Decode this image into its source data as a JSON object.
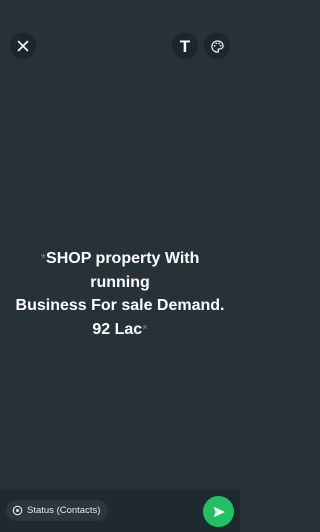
{
  "top_bar": {
    "close_icon": "close-icon",
    "text_tool_label": "T",
    "palette_icon": "palette-icon"
  },
  "status": {
    "line_1": "SHOP property With running",
    "line_2": "Business For sale Demand.",
    "line_3": "92 Lac"
  },
  "bottom_bar": {
    "audience_label": "Status (Contacts)",
    "send_icon": "send-icon"
  },
  "colors": {
    "background": "#263238",
    "send_button": "#21c063"
  }
}
